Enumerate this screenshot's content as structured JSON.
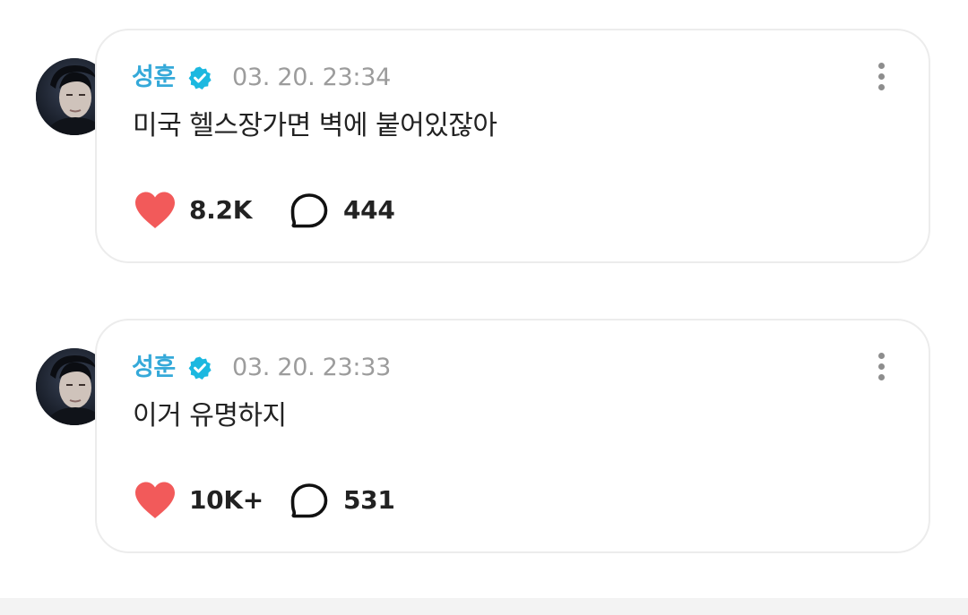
{
  "posts": [
    {
      "author": "성훈",
      "verified_icon": "verified-badge-icon",
      "timestamp": "03. 20. 23:34",
      "text": "미국 헬스장가면 벽에 붙어있잖아",
      "likes": "8.2K",
      "comments": "444"
    },
    {
      "author": "성훈",
      "verified_icon": "verified-badge-icon",
      "timestamp": "03. 20. 23:33",
      "text": "이거 유명하지",
      "likes": "10K+",
      "comments": "531"
    }
  ],
  "colors": {
    "author_name": "#35a9d9",
    "verified_badge": "#1cb8e0",
    "heart": "#f25a5a",
    "timestamp": "#9c9c9c",
    "card_border": "#ececec"
  },
  "icons": [
    "heart-icon",
    "comment-bubble-icon",
    "more-vertical-icon",
    "verified-badge-icon"
  ]
}
